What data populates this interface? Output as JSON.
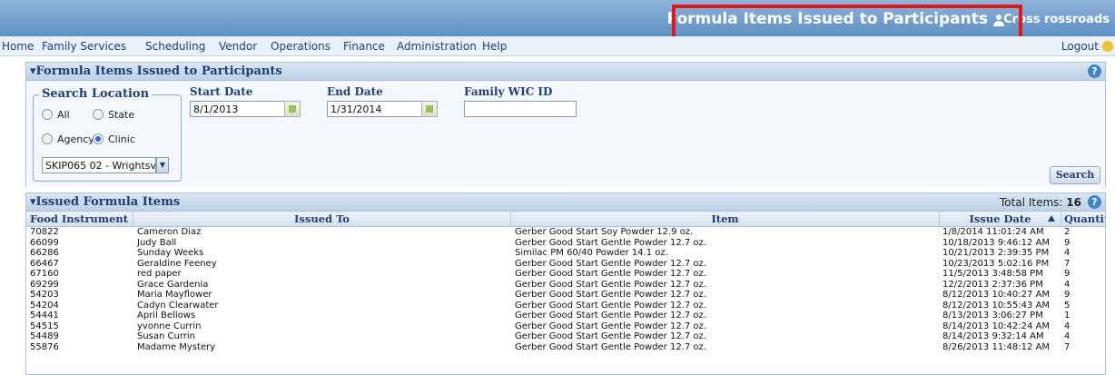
{
  "header": {
    "page_title": "Formula Items Issued to Participants",
    "user_name": "Cross rossroads"
  },
  "menu": {
    "items": [
      "Home",
      "Family Services",
      "Scheduling",
      "Vendor",
      "Operations",
      "Finance",
      "Administration",
      "Help"
    ],
    "logout_label": "Logout"
  },
  "search_panel": {
    "title": "▾Formula Items Issued to Participants",
    "location_legend": "Search Location",
    "radios": [
      {
        "label": "All",
        "selected": false
      },
      {
        "label": "State",
        "selected": false
      },
      {
        "label": "Agency",
        "selected": false
      },
      {
        "label": "Clinic",
        "selected": true
      }
    ],
    "clinic_select_value": "SKIP065 02 - Wrightsv",
    "start_date_label": "Start Date",
    "start_date_value": "8/1/2013",
    "end_date_label": "End Date",
    "end_date_value": "1/31/2014",
    "wic_id_label": "Family WIC ID",
    "wic_id_value": "",
    "search_label": "Search"
  },
  "results_panel": {
    "title": "▾Issued Formula Items",
    "total_label": "Total Items:",
    "total_value": "16",
    "columns": [
      "Food Instrument",
      "Issued To",
      "Item",
      "Issue Date",
      "Quantity"
    ],
    "rows": [
      [
        "70822",
        "Cameron Diaz",
        "Gerber Good Start Soy Powder 12.9 oz.",
        "1/8/2014 11:01:24 AM",
        "2"
      ],
      [
        "66099",
        "Judy Ball",
        "Gerber Good Start Gentle Powder 12.7 oz.",
        "10/18/2013 9:46:12 AM",
        "9"
      ],
      [
        "66286",
        "Sunday Weeks",
        "Similac PM 60/40 Powder 14.1 oz.",
        "10/21/2013 2:39:35 PM",
        "4"
      ],
      [
        "66467",
        "Geraldine Feeney",
        "Gerber Good Start Gentle Powder 12.7 oz.",
        "10/23/2013 5:02:16 PM",
        "7"
      ],
      [
        "67160",
        "red paper",
        "Gerber Good Start Gentle Powder 12.7 oz.",
        "11/5/2013 3:48:58 PM",
        "9"
      ],
      [
        "69299",
        "Grace Gardenia",
        "Gerber Good Start Gentle Powder 12.7 oz.",
        "12/2/2013 2:37:36 PM",
        "4"
      ],
      [
        "54203",
        "Maria Mayflower",
        "Gerber Good Start Gentle Powder 12.7 oz.",
        "8/12/2013 10:40:27 AM",
        "9"
      ],
      [
        "54204",
        "Cadyn Clearwater",
        "Gerber Good Start Gentle Powder 12.7 oz.",
        "8/12/2013 10:55:43 AM",
        "5"
      ],
      [
        "54441",
        "April Bellows",
        "Gerber Good Start Gentle Powder 12.7 oz.",
        "8/13/2013 3:06:27 PM",
        "1"
      ],
      [
        "54515",
        "yvonne Currin",
        "Gerber Good Start Gentle Powder 12.7 oz.",
        "8/14/2013 10:42:24 AM",
        "4"
      ],
      [
        "54489",
        "Susan Currin",
        "Gerber Good Start Gentle Powder 12.7 oz.",
        "8/14/2013 9:32:14 AM",
        "4"
      ],
      [
        "55876",
        "Madame Mystery",
        "Gerber Good Start Gentle Powder 12.7 oz.",
        "8/26/2013 11:48:12 AM",
        "7"
      ]
    ]
  },
  "colors": {
    "header_blue": "#6f9fd0",
    "highlight_red": "#e01818",
    "link_navy": "#1f3f74"
  }
}
